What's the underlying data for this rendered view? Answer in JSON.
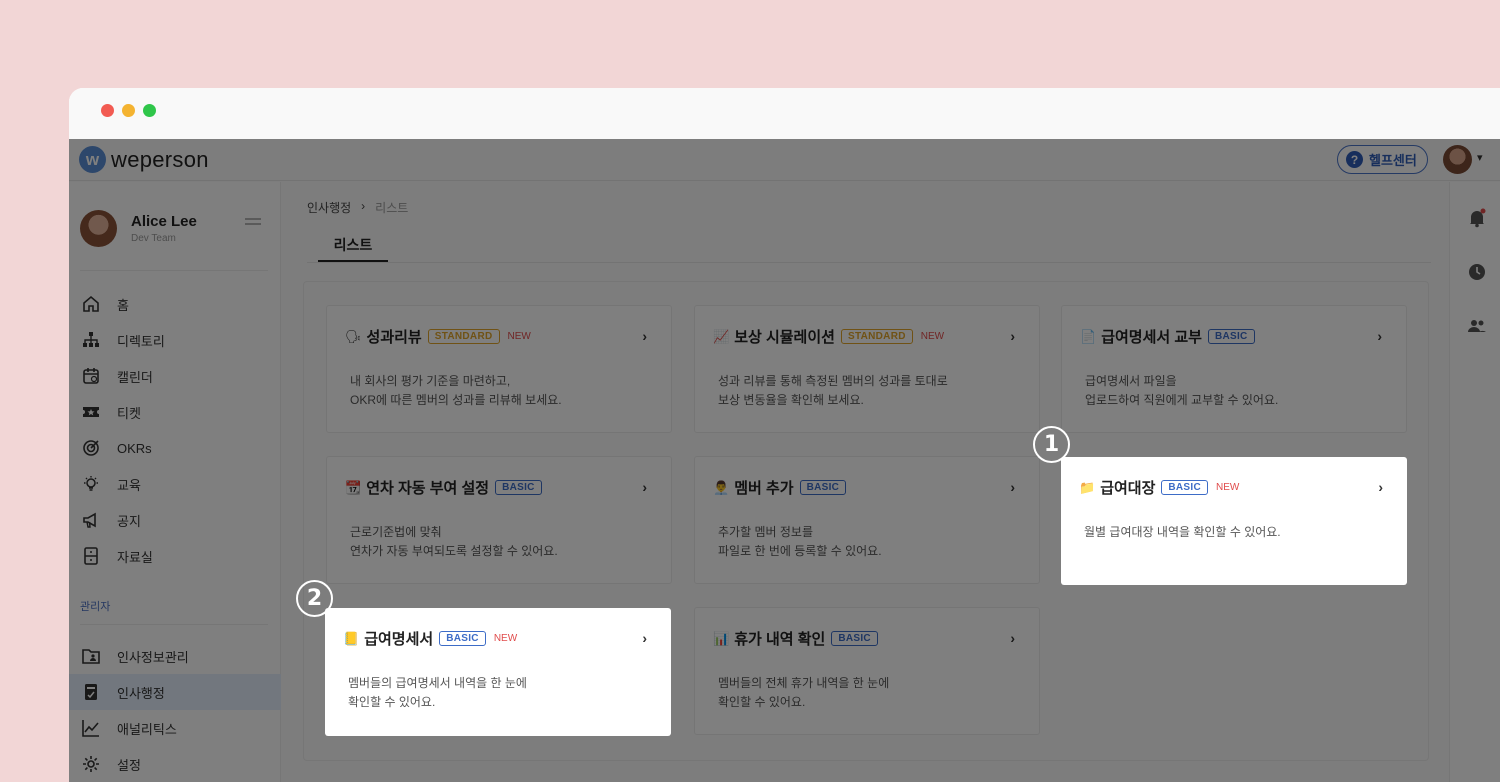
{
  "header": {
    "logo_mark": "w",
    "logo_text": "weperson",
    "help_label": "헬프센터",
    "help_icon": "?"
  },
  "profile": {
    "name": "Alice Lee",
    "team": "Dev Team"
  },
  "sidebar": {
    "items": [
      {
        "label": "홈",
        "icon": "home-icon"
      },
      {
        "label": "디렉토리",
        "icon": "org-chart-icon"
      },
      {
        "label": "캘린더",
        "icon": "calendar-icon"
      },
      {
        "label": "티켓",
        "icon": "ticket-icon"
      },
      {
        "label": "OKRs",
        "icon": "target-icon"
      },
      {
        "label": "교육",
        "icon": "lightbulb-icon"
      },
      {
        "label": "공지",
        "icon": "megaphone-icon"
      },
      {
        "label": "자료실",
        "icon": "archive-icon"
      }
    ],
    "admin_label": "관리자",
    "admin_items": [
      {
        "label": "인사정보관리",
        "icon": "folder-person-icon"
      },
      {
        "label": "인사행정",
        "icon": "document-icon",
        "active": true
      },
      {
        "label": "애널리틱스",
        "icon": "chart-line-icon"
      },
      {
        "label": "설정",
        "icon": "gear-icon"
      }
    ]
  },
  "breadcrumb": {
    "parent": "인사행정",
    "separator": "›",
    "current": "리스트"
  },
  "tab": {
    "label": "리스트"
  },
  "cards": [
    {
      "emoji": "🗣",
      "title": "성과리뷰",
      "badge": "STANDARD",
      "new": "NEW",
      "desc1": "내 회사의 평가 기준을 마련하고,",
      "desc2": "OKR에 따른 멤버의 성과를 리뷰해 보세요."
    },
    {
      "emoji": "📈",
      "title": "보상 시뮬레이션",
      "badge": "STANDARD",
      "new": "NEW",
      "desc1": "성과 리뷰를 통해 측정된 멤버의 성과를 토대로",
      "desc2": "보상 변동율을 확인해 보세요."
    },
    {
      "emoji": "📄",
      "title": "급여명세서 교부",
      "badge": "BASIC",
      "new": "",
      "desc1": "급여명세서 파일을",
      "desc2": "업로드하여 직원에게 교부할 수 있어요."
    },
    {
      "emoji": "📆",
      "title": "연차 자동 부여 설정",
      "badge": "BASIC",
      "new": "",
      "desc1": "근로기준법에 맞춰",
      "desc2": "연차가 자동 부여되도록 설정할 수 있어요."
    },
    {
      "emoji": "👨‍💼",
      "title": "멤버 추가",
      "badge": "BASIC",
      "new": "",
      "desc1": "추가할 멤버 정보를",
      "desc2": "파일로 한 번에 등록할 수 있어요."
    },
    {
      "emoji": "📁",
      "title": "급여대장",
      "badge": "BASIC",
      "new": "NEW",
      "desc1": "월별 급여대장 내역을 확인할 수 있어요.",
      "desc2": ""
    },
    {
      "emoji": "📒",
      "title": "급여명세서",
      "badge": "BASIC",
      "new": "NEW",
      "desc1": "멤버들의 급여명세서 내역을 한 눈에",
      "desc2": "확인할 수 있어요."
    },
    {
      "emoji": "📊",
      "title": "휴가 내역 확인",
      "badge": "BASIC",
      "new": "",
      "desc1": "멤버들의 전체 휴가 내역을 한 눈에",
      "desc2": "확인할 수 있어요."
    }
  ],
  "callouts": {
    "one": "1",
    "two": "2"
  },
  "chevron": "›"
}
